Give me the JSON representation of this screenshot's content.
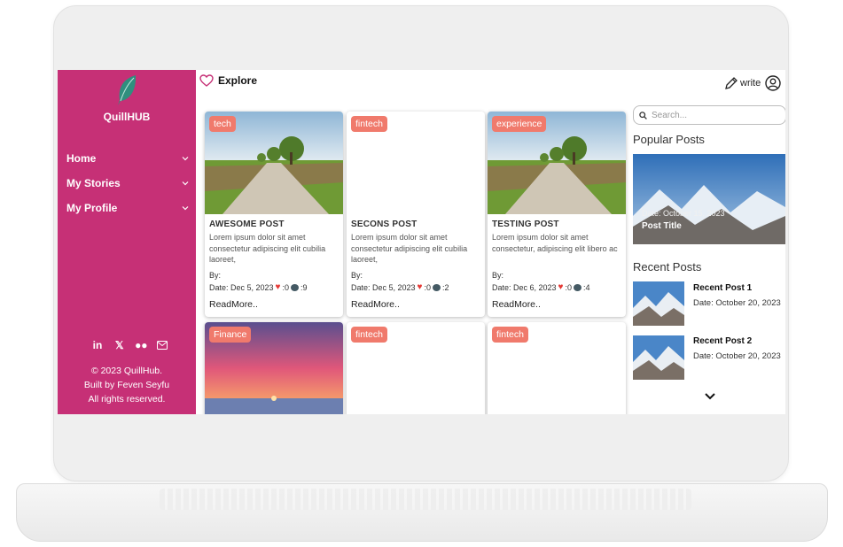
{
  "app": {
    "brand": "QuillHUB",
    "colors": {
      "sidebar": "#c63076",
      "tag": "#f07a6c",
      "heart": "#e53935"
    }
  },
  "sidebar": {
    "items": [
      {
        "label": "Home"
      },
      {
        "label": "My Stories"
      },
      {
        "label": "My Profile"
      }
    ],
    "socials": [
      "linkedin-icon",
      "x-icon",
      "medium-icon",
      "mail-icon"
    ],
    "footer": [
      "© 2023 QuillHub.",
      "Built by Feven Seyfu",
      "All rights reserved."
    ]
  },
  "header": {
    "explore_label": "Explore",
    "write_label": "write"
  },
  "posts": [
    {
      "tag": "tech",
      "title": "AWESOME POST",
      "excerpt": "Lorem ipsum dolor sit amet consectetur adipiscing elit cubilia laoreet,",
      "by": "By:",
      "date": "Date: Dec 5, 2023",
      "likes": ":0",
      "comments": ":9",
      "readmore": "ReadMore.."
    },
    {
      "tag": "fintech",
      "title": "SECONS POST",
      "excerpt": "Lorem ipsum dolor sit amet consectetur adipiscing elit cubilia laoreet,",
      "by": "By:",
      "date": "Date: Dec 5, 2023",
      "likes": ":0",
      "comments": ":2",
      "readmore": "ReadMore.."
    },
    {
      "tag": "experience",
      "title": "TESTING POST",
      "excerpt": "Lorem ipsum dolor sit amet consectetur, adipiscing elit libero ac",
      "by": "By:",
      "date": "Date: Dec 6, 2023",
      "likes": ":0",
      "comments": ":4",
      "readmore": "ReadMore.."
    },
    {
      "tag": "Finance"
    },
    {
      "tag": "fintech"
    },
    {
      "tag": "fintech"
    }
  ],
  "search": {
    "placeholder": "Search..."
  },
  "popular": {
    "heading": "Popular Posts",
    "date": "Date: October 15, 2023",
    "title": "Post Title"
  },
  "recent": {
    "heading": "Recent Posts",
    "items": [
      {
        "title": "Recent Post 1",
        "date": "Date: October 20, 2023"
      },
      {
        "title": "Recent Post 2",
        "date": "Date: October 20, 2023"
      }
    ]
  }
}
